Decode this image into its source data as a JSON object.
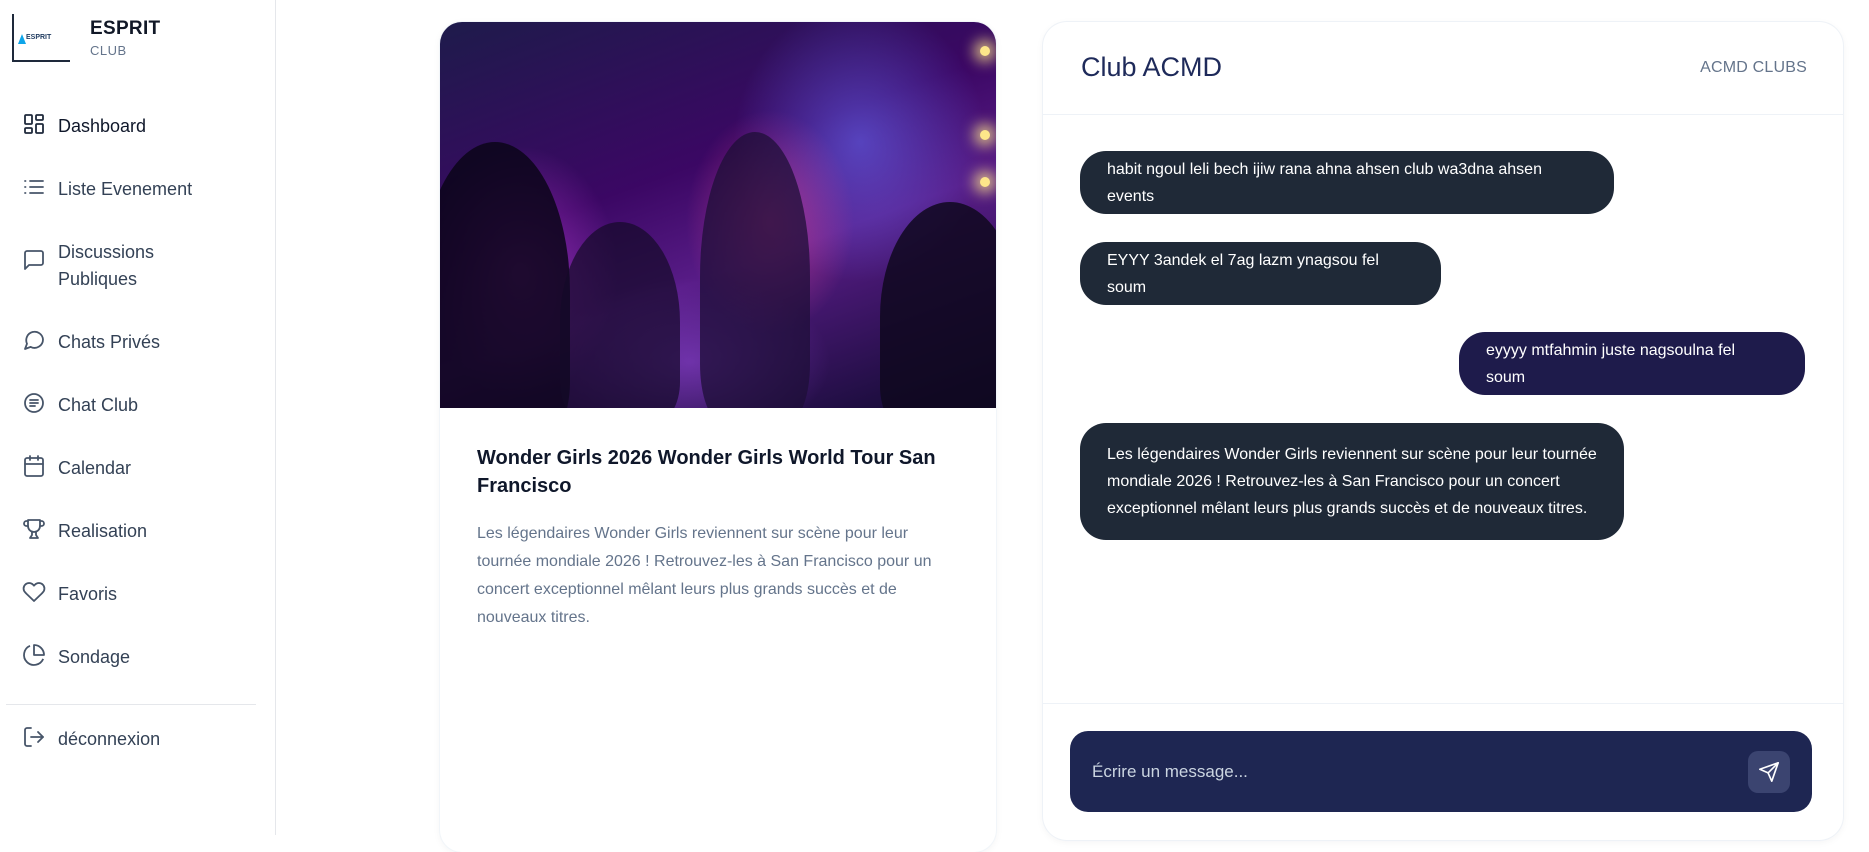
{
  "brand": {
    "name": "ESPRIT",
    "sub": "CLUB",
    "logo_text": "ESPRIT"
  },
  "sidebar": {
    "items": [
      {
        "label": "Dashboard",
        "icon": "dashboard-icon"
      },
      {
        "label": "Liste Evenement",
        "icon": "list-icon"
      },
      {
        "label": "Discussions Publiques",
        "icon": "message-square-icon"
      },
      {
        "label": "Chats Privés",
        "icon": "message-circle-icon"
      },
      {
        "label": "Chat Club",
        "icon": "chat-club-icon"
      },
      {
        "label": "Calendar",
        "icon": "calendar-icon"
      },
      {
        "label": "Realisation",
        "icon": "trophy-icon"
      },
      {
        "label": "Favoris",
        "icon": "heart-icon"
      },
      {
        "label": "Sondage",
        "icon": "pie-chart-icon"
      }
    ],
    "logout": {
      "label": "déconnexion",
      "icon": "logout-icon"
    }
  },
  "event": {
    "title": "Wonder Girls 2026 Wonder Girls World Tour San Francisco",
    "description": "Les légendaires Wonder Girls reviennent sur scène pour leur tournée mondiale 2026 ! Retrouvez-les à San Francisco pour un concert exceptionnel mêlant leurs plus grands succès et de nouveaux titres."
  },
  "chat": {
    "title": "Club ACMD",
    "club_label": "ACMD CLUBS",
    "messages": [
      {
        "text": "habit ngoul leli bech ijiw rana ahna ahsen club wa3dna ahsen events",
        "direction": "received"
      },
      {
        "text": "EYYY 3andek el 7ag lazm ynagsou fel soum",
        "direction": "received"
      },
      {
        "text": "eyyyy mtfahmin juste nagsoulna fel soum",
        "direction": "sent"
      },
      {
        "text": "Les légendaires Wonder Girls reviennent sur scène pour leur tournée mondiale 2026 ! Retrouvez-les à San Francisco pour un concert exceptionnel mêlant leurs plus grands succès et de nouveaux titres.",
        "direction": "received"
      }
    ],
    "input": {
      "placeholder": "Écrire un message...",
      "value": ""
    },
    "send_icon": "send-icon"
  },
  "colors": {
    "received_bubble": "#1f2937",
    "sent_bubble": "#1e1b4b",
    "input_bar": "#1e2652",
    "title": "#1e2a5a"
  }
}
